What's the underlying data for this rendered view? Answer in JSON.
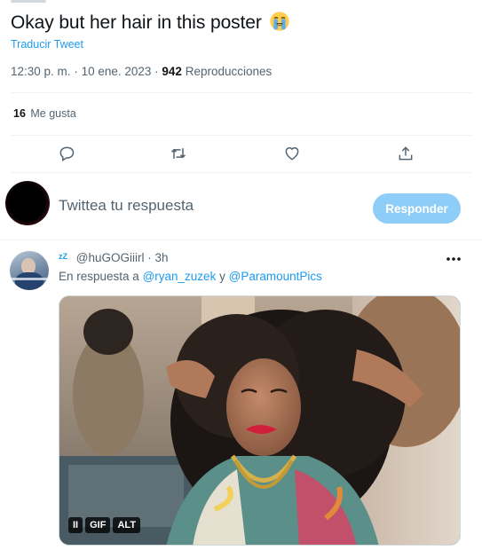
{
  "tweet": {
    "text": "Okay but her hair in this poster",
    "emoji": "loudly-crying-face",
    "translate_label": "Traducir Tweet",
    "time": "12:30 p. m.",
    "date": "10 ene. 2023",
    "views_count": "942",
    "views_label": "Reproducciones",
    "likes_count": "16",
    "likes_label": "Me gusta"
  },
  "actions": [
    "reply-icon",
    "retweet-icon",
    "like-icon",
    "share-icon"
  ],
  "reply_box": {
    "placeholder": "Twittea tu respuesta",
    "button_label": "Responder",
    "button_color": "#8ecdf7"
  },
  "reply": {
    "zz_mark": "zZ",
    "handle": "@huGOGiiirl",
    "separator": "·",
    "time": "3h",
    "replying_prefix": "En respuesta a",
    "mention_1": "@ryan_zuzek",
    "conjunction": "y",
    "mention_2": "@ParamountPics",
    "media_badges": [
      "II",
      "GIF",
      "ALT"
    ]
  },
  "colors": {
    "accent": "#1d9bf0",
    "text": "#0f1419",
    "secondary": "#536471",
    "divider": "#eff3f4"
  }
}
